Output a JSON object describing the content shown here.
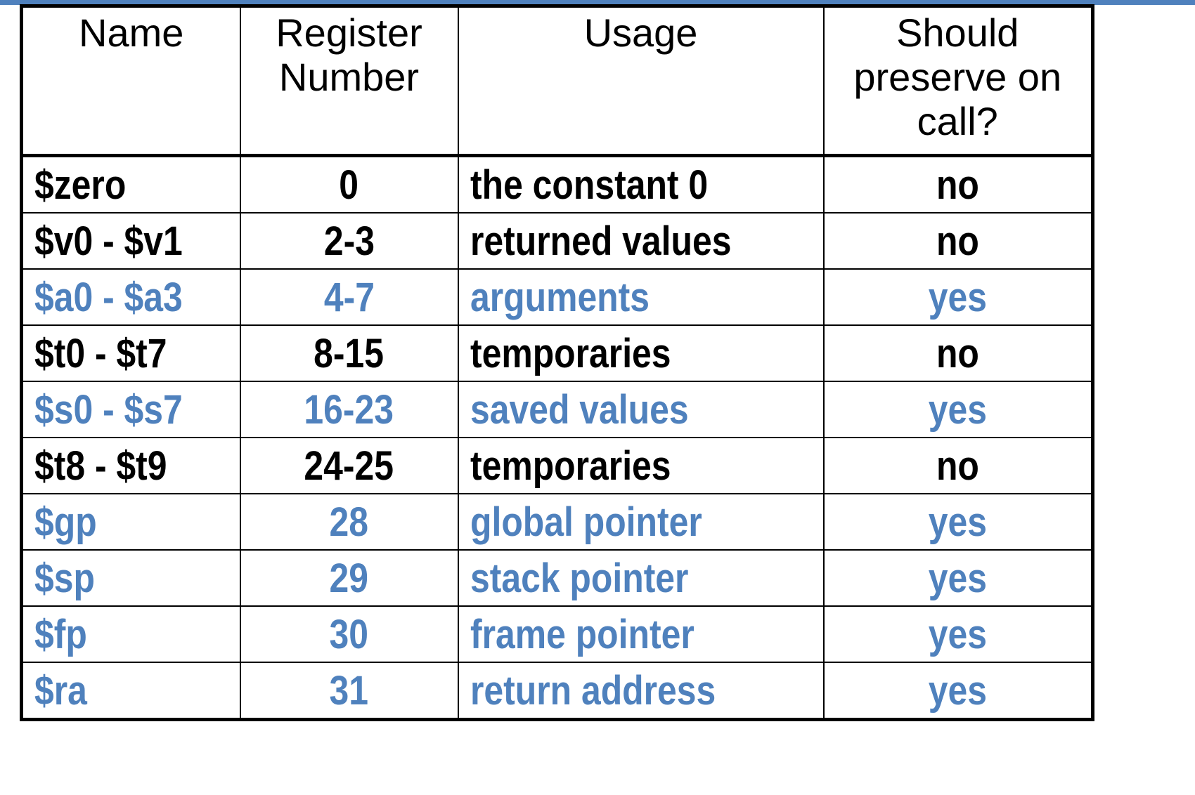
{
  "theme": {
    "accent_color": "#4F81BD",
    "text_color": "#000000"
  },
  "table": {
    "headers": [
      "Name",
      "Register Number",
      "Usage",
      "Should preserve on call?"
    ],
    "rows": [
      {
        "name": "$zero",
        "number": "0",
        "usage": "the constant 0",
        "preserve": "no",
        "highlight": false
      },
      {
        "name": "$v0 - $v1",
        "number": "2-3",
        "usage": "returned values",
        "preserve": "no",
        "highlight": false
      },
      {
        "name": "$a0 - $a3",
        "number": "4-7",
        "usage": "arguments",
        "preserve": "yes",
        "highlight": true
      },
      {
        "name": "$t0 - $t7",
        "number": "8-15",
        "usage": "temporaries",
        "preserve": "no",
        "highlight": false
      },
      {
        "name": "$s0 - $s7",
        "number": "16-23",
        "usage": "saved values",
        "preserve": "yes",
        "highlight": true
      },
      {
        "name": "$t8 - $t9",
        "number": "24-25",
        "usage": "temporaries",
        "preserve": "no",
        "highlight": false
      },
      {
        "name": "$gp",
        "number": "28",
        "usage": "global pointer",
        "preserve": "yes",
        "highlight": true
      },
      {
        "name": "$sp",
        "number": "29",
        "usage": "stack pointer",
        "preserve": "yes",
        "highlight": true
      },
      {
        "name": "$fp",
        "number": "30",
        "usage": "frame pointer",
        "preserve": "yes",
        "highlight": true
      },
      {
        "name": "$ra",
        "number": "31",
        "usage": "return address",
        "preserve": "yes",
        "highlight": true
      }
    ]
  }
}
